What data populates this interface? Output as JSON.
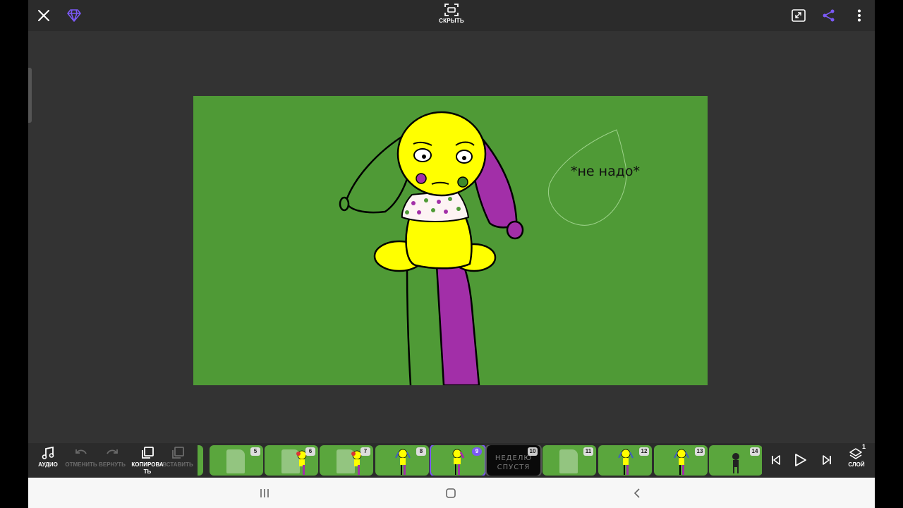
{
  "topbar": {
    "close_icon": "close-icon",
    "premium_icon": "diamond-icon",
    "hide_label": "СКРЫТЬ",
    "fullscreen_icon": "expand-icon",
    "share_icon": "share-icon",
    "more_icon": "more-vertical-icon"
  },
  "canvas": {
    "background": "#4f9a36",
    "speech_text": "*не надо*"
  },
  "toolbar": {
    "audio_label": "АУДИО",
    "undo_label": "ОТМЕНИТЬ",
    "redo_label": "ВЕРНУТЬ",
    "copy_label": "КОПИРОВА ТЬ",
    "paste_label": "ВСТАВИТЬ",
    "layer_label": "СЛОЙ",
    "layer_count": "1"
  },
  "frames": [
    {
      "num": "5",
      "kind": "ghost"
    },
    {
      "num": "6",
      "kind": "ghost-figure"
    },
    {
      "num": "7",
      "kind": "ghost-figure"
    },
    {
      "num": "8",
      "kind": "figure"
    },
    {
      "num": "9",
      "kind": "figure",
      "active": true
    },
    {
      "num": "10",
      "kind": "dark",
      "text_line1": "НЕДЕЛЮ",
      "text_line2": "СПУСТЯ"
    },
    {
      "num": "11",
      "kind": "ghost"
    },
    {
      "num": "12",
      "kind": "figure"
    },
    {
      "num": "13",
      "kind": "figure"
    },
    {
      "num": "14",
      "kind": "dark-figure"
    }
  ],
  "playback": {
    "first_icon": "skip-to-start-icon",
    "play_icon": "play-icon",
    "last_icon": "skip-to-end-icon"
  },
  "colors": {
    "accent": "#7b59f5",
    "canvas_green": "#4f9a36",
    "character_yellow": "#ffff00",
    "character_purple": "#a22fa8"
  }
}
